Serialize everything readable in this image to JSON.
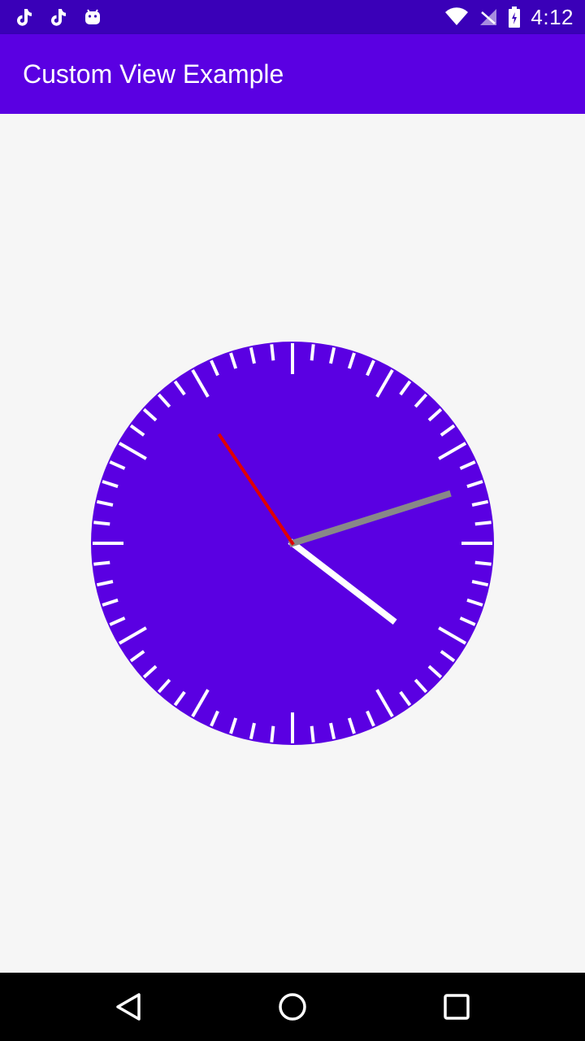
{
  "status_bar": {
    "time": "4:12",
    "left_icons": [
      "tiktok-icon",
      "tiktok-icon",
      "android-icon"
    ],
    "right_icons": [
      "wifi-icon",
      "signal-icon",
      "battery-icon"
    ]
  },
  "app_bar": {
    "title": "Custom View Example"
  },
  "clock": {
    "face_color": "#5a00e2",
    "tick_color": "#ffffff",
    "time": {
      "hour": 4,
      "minute": 12,
      "second": 54
    },
    "hands": {
      "hour_color": "#ffffff",
      "minute_color": "#888888",
      "second_color": "#e00000"
    }
  },
  "nav_bar": {
    "buttons": [
      "back-icon",
      "home-icon",
      "recents-icon"
    ]
  },
  "colors": {
    "status_bar": "#3a00b8",
    "app_bar": "#5a00e2",
    "background": "#f6f6f6"
  }
}
